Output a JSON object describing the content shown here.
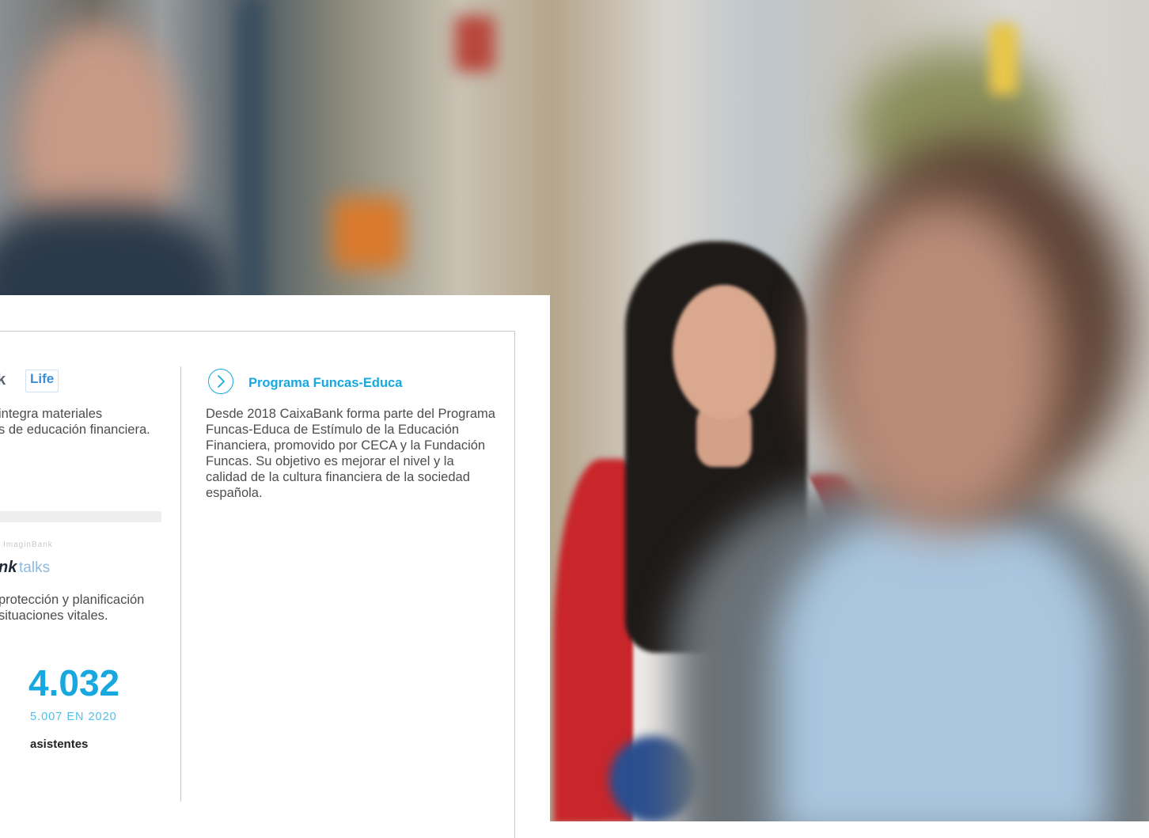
{
  "left_column": {
    "logo_partial": "k",
    "logo_life": "Life",
    "text_top": "integra materiales\ns de educación financiera.",
    "small_caption": "ImaginBank",
    "logo_talks_bold": "nk",
    "logo_talks_light": "talks",
    "text_bottom": "protección y planificación\nsituaciones vitales.",
    "stat_value": "4.032",
    "stat_previous": "5.007 EN 2020",
    "stat_label": "asistentes"
  },
  "right_column": {
    "title": "Programa Funcas-Educa",
    "body": "Desde 2018 CaixaBank forma parte del Programa Funcas-Educa de Estímulo de la Educación Financiera, promovido por CECA y la Fundación Funcas. Su objetivo es mejorar el nivel y la calidad de la cultura financiera de la sociedad española."
  },
  "colors": {
    "accent": "#17a8e0",
    "text": "#4d4d4d",
    "rule": "#c9c9c9"
  },
  "icons": {
    "title_icon": "chevron-right-circle-icon"
  }
}
